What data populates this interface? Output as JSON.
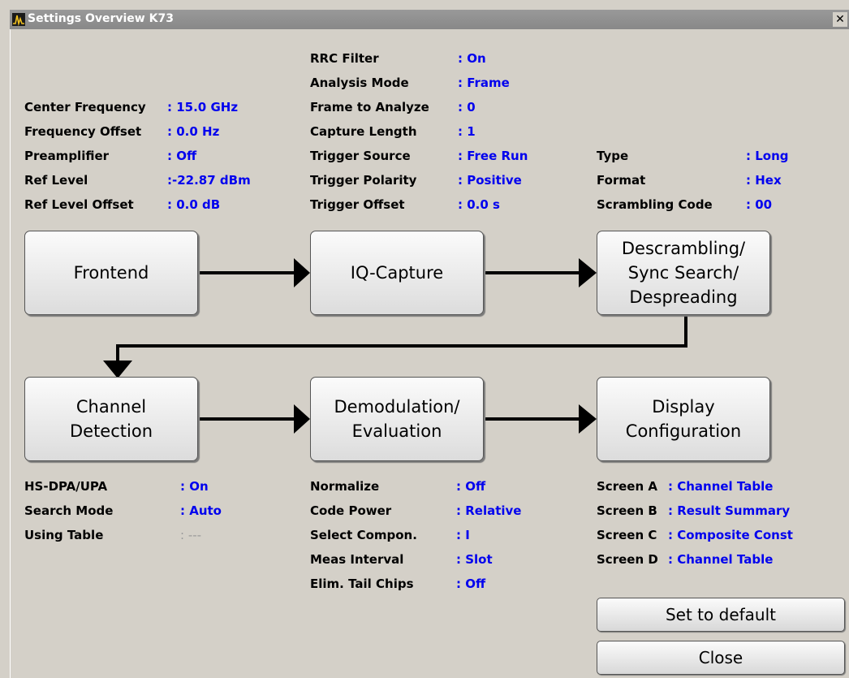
{
  "window": {
    "title": "Settings Overview K73",
    "close_glyph": "✕"
  },
  "settings": {
    "rrc_filter": {
      "label": "RRC Filter",
      "value": ": On"
    },
    "analysis_mode": {
      "label": "Analysis Mode",
      "value": ": Frame"
    },
    "center_frequency": {
      "label": "Center Frequency",
      "value": ": 15.0 GHz"
    },
    "frame_to_analyze": {
      "label": "Frame to Analyze",
      "value": ": 0"
    },
    "frequency_offset": {
      "label": "Frequency Offset",
      "value": ": 0.0 Hz"
    },
    "capture_length": {
      "label": "Capture Length",
      "value": ": 1"
    },
    "preamplifier": {
      "label": "Preamplifier",
      "value": ": Off"
    },
    "trigger_source": {
      "label": "Trigger Source",
      "value": ": Free Run"
    },
    "type": {
      "label": "Type",
      "value": ": Long"
    },
    "ref_level": {
      "label": "Ref Level",
      "value": ":-22.87 dBm"
    },
    "trigger_polarity": {
      "label": "Trigger Polarity",
      "value": ": Positive"
    },
    "format": {
      "label": "Format",
      "value": ": Hex"
    },
    "ref_level_offset": {
      "label": "Ref Level Offset",
      "value": ": 0.0 dB"
    },
    "trigger_offset": {
      "label": "Trigger Offset",
      "value": ": 0.0 s"
    },
    "scrambling_code": {
      "label": "Scrambling Code",
      "value": ": 00"
    },
    "hs_dpa_upa": {
      "label": "HS-DPA/UPA",
      "value": ": On"
    },
    "search_mode": {
      "label": "Search Mode",
      "value": ": Auto"
    },
    "using_table": {
      "label": "Using Table",
      "value": ": ---"
    },
    "normalize": {
      "label": "Normalize",
      "value": ": Off"
    },
    "code_power": {
      "label": "Code Power",
      "value": ": Relative"
    },
    "select_compon": {
      "label": "Select Compon.",
      "value": ": I"
    },
    "meas_interval": {
      "label": "Meas Interval",
      "value": ": Slot"
    },
    "elim_tail_chips": {
      "label": "Elim. Tail Chips",
      "value": ": Off"
    },
    "screen_a": {
      "label": "Screen A",
      "value": ": Channel Table"
    },
    "screen_b": {
      "label": "Screen B",
      "value": ": Result Summary"
    },
    "screen_c": {
      "label": "Screen C",
      "value": ": Composite Const"
    },
    "screen_d": {
      "label": "Screen D",
      "value": ": Channel Table"
    }
  },
  "blocks": {
    "frontend": "Frontend",
    "iq_capture": "IQ-Capture",
    "descrambling": "Descrambling/\nSync Search/\nDespreading",
    "channel_detection": "Channel\nDetection",
    "demodulation": "Demodulation/\nEvaluation",
    "display_configuration": "Display\nConfiguration"
  },
  "buttons": {
    "set_to_default": "Set to default",
    "close": "Close"
  },
  "colors": {
    "value_blue": "#0000ee",
    "background": "#d4d0c8",
    "title_bar": "#8c8c8c"
  }
}
